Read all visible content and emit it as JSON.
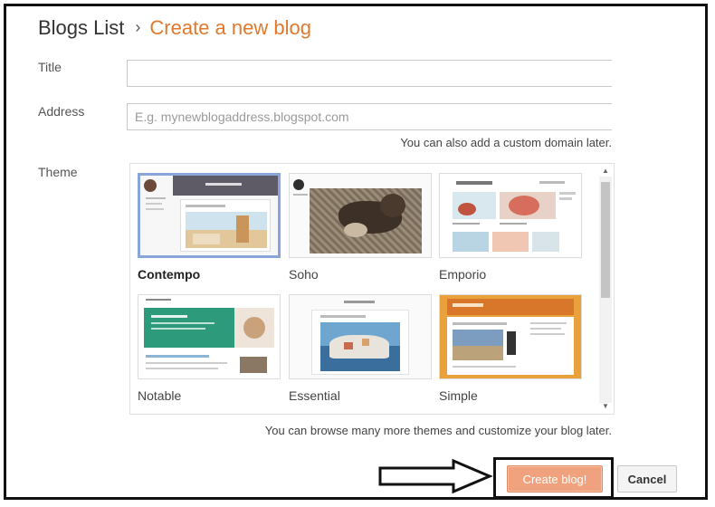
{
  "breadcrumb": {
    "root": "Blogs List",
    "separator": "›",
    "current": "Create a new blog"
  },
  "form": {
    "title_label": "Title",
    "title_value": "",
    "address_label": "Address",
    "address_placeholder": "E.g. mynewblogaddress.blogspot.com",
    "address_hint": "You can also add a custom domain later.",
    "theme_label": "Theme",
    "theme_hint": "You can browse many more themes and customize your blog later."
  },
  "themes": [
    {
      "name": "Contempo",
      "selected": true
    },
    {
      "name": "Soho",
      "selected": false
    },
    {
      "name": "Emporio",
      "selected": false
    },
    {
      "name": "Notable",
      "selected": false
    },
    {
      "name": "Essential",
      "selected": false
    },
    {
      "name": "Simple",
      "selected": false
    }
  ],
  "actions": {
    "create_label": "Create blog!",
    "cancel_label": "Cancel"
  },
  "colors": {
    "accent": "#e0792c",
    "create_button": "#f0a27e",
    "selection": "#8aa6d8"
  },
  "icons": {
    "annotation": "right-arrow-icon",
    "scroll_up": "scroll-up-icon",
    "scroll_down": "scroll-down-icon"
  }
}
